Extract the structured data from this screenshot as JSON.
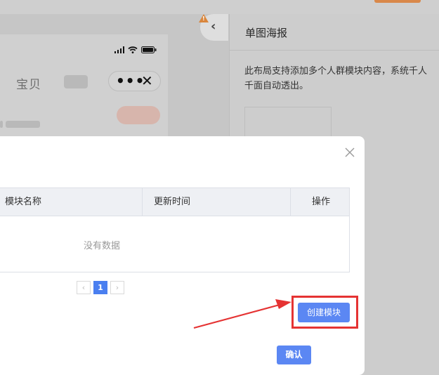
{
  "phone_preview": {
    "title_text": "宝贝",
    "more_glyph": "•••",
    "close_glyph": "✕"
  },
  "right_panel": {
    "title": "单图海报",
    "description": "此布局支持添加多个人群模块内容，系统千人千面自动透出。"
  },
  "sidebar_toggle": {
    "chevron": "‹",
    "warning_mark": "!"
  },
  "modal": {
    "table": {
      "columns": [
        "模块名称",
        "更新时间",
        "操作"
      ],
      "empty_text": "没有数据"
    },
    "pagination": {
      "prev": "‹",
      "current_page": "1",
      "next": "›"
    },
    "create_button": "创建模块",
    "confirm_button": "确认"
  },
  "colors": {
    "primary_button": "#5b87f3",
    "annotation_red": "#e53333",
    "warning_orange": "#d9863c",
    "overlay_grey": "#c9c9c9"
  },
  "icons": {
    "close": "close-icon",
    "signal": "signal-icon",
    "wifi": "wifi-icon",
    "battery": "battery-icon",
    "warning": "warning-icon",
    "chevron_left": "chevron-left-icon"
  }
}
